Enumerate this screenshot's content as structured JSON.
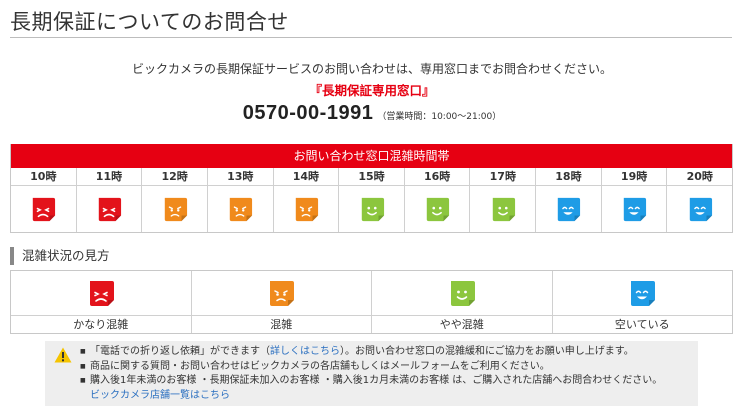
{
  "page_title": "長期保証についてのお問合せ",
  "intro": "ビックカメラの長期保証サービスのお問い合わせは、専用窓口までお問合わせください。",
  "desk_name": "『長期保証専用窓口』",
  "phone": "0570-00-1991",
  "hours": "（営業時間：10:00～21:00）",
  "schedule": {
    "header": "お問い合わせ窓口混雑時間帯",
    "slots": [
      {
        "time": "10時",
        "level": "very-busy"
      },
      {
        "time": "11時",
        "level": "very-busy"
      },
      {
        "time": "12時",
        "level": "busy"
      },
      {
        "time": "13時",
        "level": "busy"
      },
      {
        "time": "14時",
        "level": "busy"
      },
      {
        "time": "15時",
        "level": "slightly-busy"
      },
      {
        "time": "16時",
        "level": "slightly-busy"
      },
      {
        "time": "17時",
        "level": "slightly-busy"
      },
      {
        "time": "18時",
        "level": "available"
      },
      {
        "time": "19時",
        "level": "available"
      },
      {
        "time": "20時",
        "level": "available"
      }
    ]
  },
  "legend": {
    "title": "混雑状況の見方",
    "items": [
      {
        "level": "very-busy",
        "label": "かなり混雑"
      },
      {
        "level": "busy",
        "label": "混雑"
      },
      {
        "level": "slightly-busy",
        "label": "やや混雑"
      },
      {
        "level": "available",
        "label": "空いている"
      }
    ]
  },
  "level_colors": {
    "very-busy": "#e3131b",
    "busy": "#f08a1c",
    "slightly-busy": "#8cc63e",
    "available": "#1e9ce6"
  },
  "notice": {
    "icon": "warning-icon",
    "line1_pre": "「電話での折り返し依頼」ができます（",
    "line1_link": "詳しくはこちら",
    "line1_post": "）。お問い合わせ窓口の混雑緩和にご協力をお願い申し上げます。",
    "line2": "商品に関する質問・お問い合わせはビックカメラの各店舗もしくはメールフォームをご利用ください。",
    "line3": "購入後1年未満のお客様 ・長期保証未加入のお客様 ・購入後1カ月未満のお客様 は、ご購入された店舗へお問合わせください。",
    "store_link": "ビックカメラ店舗一覧はこちら"
  }
}
